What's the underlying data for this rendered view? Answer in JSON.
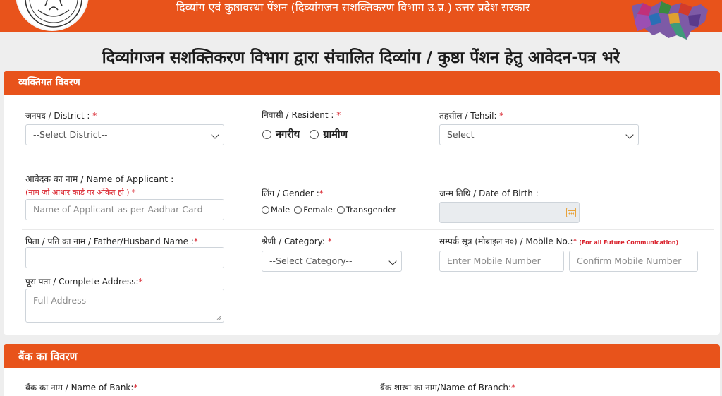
{
  "header": {
    "title": "दिव्यांग एवं कुष्ठावस्था पेंशन (दिव्यांगजन सशक्तिकरण विभाग उ.प्र.) उत्तर प्रदेश सरकार"
  },
  "page": {
    "headline": "दिव्यांगजन सशक्तिकरण विभाग द्वारा संचालित दिव्यांग / कुष्ठा पेंशन हेतु आवेदन-पत्र भरे"
  },
  "personal": {
    "section_title": "व्यक्तिगत विवरण",
    "district": {
      "label": "जनपद / District : ",
      "required": "*",
      "value": "--Select District--"
    },
    "resident": {
      "label": "निवासी / Resident : ",
      "required": "*",
      "options": [
        "नगरीय",
        "ग्रामीण"
      ]
    },
    "tehsil": {
      "label": "तहसील / Tehsil: ",
      "required": "*",
      "value": "Select"
    },
    "applicant": {
      "label": "आवेदक का नाम / Name of Applicant :",
      "hint": "(नाम जो आधार कार्ड पर अंकित हो )",
      "required": " *",
      "placeholder": "Name of Applicant as per Aadhar Card"
    },
    "gender": {
      "label": "लिंग / Gender :",
      "required": "*",
      "options": [
        "Male",
        "Female",
        "Transgender"
      ]
    },
    "dob": {
      "label": "जन्म तिथि / Date of Birth :"
    },
    "father": {
      "label": "पिता / पति का नाम / Father/Husband Name :",
      "required": "*"
    },
    "category": {
      "label": "श्रेणी / Category: ",
      "required": "*",
      "value": "--Select Category--"
    },
    "mobile": {
      "label": "सम्पर्क सूत्र (मोबाइल न०) / Mobile No.:",
      "required": "*",
      "note": " (For all Future Communication)",
      "placeholder": "Enter Mobile Number",
      "confirm_placeholder": "Confirm Mobile Number"
    },
    "address": {
      "label": "पूरा पता / Complete Address:",
      "required": "*",
      "placeholder": "Full Address"
    }
  },
  "bank": {
    "section_title": "बैंक का विवरण",
    "bank_name": {
      "label": "बैंक का नाम / Name of Bank:",
      "required": "*"
    },
    "branch": {
      "label": "बैंक शाखा का नाम/Name of Branch:",
      "required": "*"
    }
  },
  "colors": {
    "accent": "#e8531b",
    "required": "#d9232d"
  },
  "icons": [
    "emblem-logo",
    "state-map",
    "calendar-icon",
    "chevron-down-icon"
  ]
}
